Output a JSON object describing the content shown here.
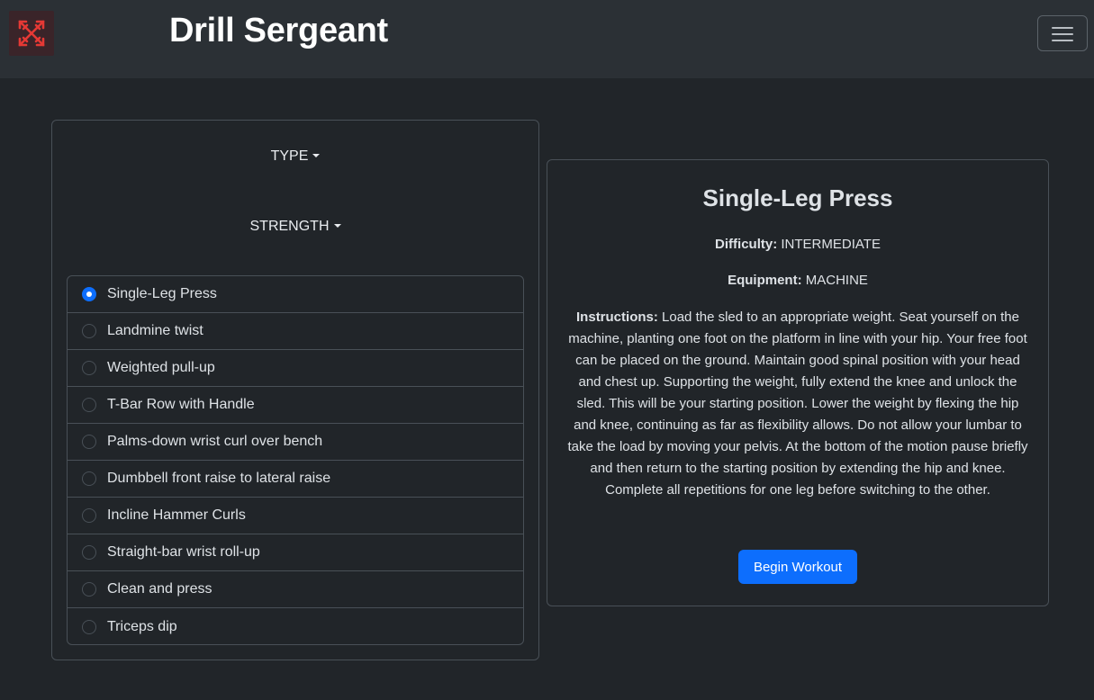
{
  "app": {
    "title": "Drill Sergeant",
    "logo_icon": "crossed-arrows-icon",
    "accent_color": "#0d6efd",
    "logo_color": "#e53935"
  },
  "filters": {
    "type_label": "TYPE",
    "category_label": "STRENGTH"
  },
  "exercises": [
    {
      "name": "Single-Leg Press",
      "selected": true
    },
    {
      "name": "Landmine twist",
      "selected": false
    },
    {
      "name": "Weighted pull-up",
      "selected": false
    },
    {
      "name": "T-Bar Row with Handle",
      "selected": false
    },
    {
      "name": "Palms-down wrist curl over bench",
      "selected": false
    },
    {
      "name": "Dumbbell front raise to lateral raise",
      "selected": false
    },
    {
      "name": "Incline Hammer Curls",
      "selected": false
    },
    {
      "name": "Straight-bar wrist roll-up",
      "selected": false
    },
    {
      "name": "Clean and press",
      "selected": false
    },
    {
      "name": "Triceps dip",
      "selected": false
    }
  ],
  "detail": {
    "title": "Single-Leg Press",
    "difficulty_label": "Difficulty:",
    "difficulty": "INTERMEDIATE",
    "equipment_label": "Equipment:",
    "equipment": "MACHINE",
    "instructions_label": "Instructions:",
    "instructions": "Load the sled to an appropriate weight. Seat yourself on the machine, planting one foot on the platform in line with your hip. Your free foot can be placed on the ground. Maintain good spinal position with your head and chest up. Supporting the weight, fully extend the knee and unlock the sled. This will be your starting position. Lower the weight by flexing the hip and knee, continuing as far as flexibility allows. Do not allow your lumbar to take the load by moving your pelvis. At the bottom of the motion pause briefly and then return to the starting position by extending the hip and knee. Complete all repetitions for one leg before switching to the other.",
    "begin_label": "Begin Workout"
  }
}
